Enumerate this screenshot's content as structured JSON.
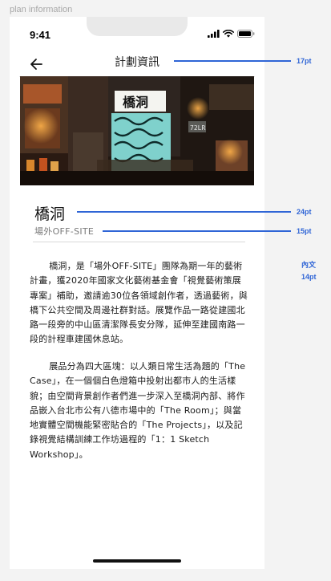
{
  "canvas_label": "plan information",
  "status_bar": {
    "time": "9:41"
  },
  "header": {
    "title": "計劃資訊"
  },
  "hero": {
    "sign_text": "橋洞",
    "plate_text": "72LR"
  },
  "content": {
    "title": "橋洞",
    "subtitle": "場外OFF-SITE",
    "paragraphs": [
      "橋洞，是「場外OFF-SITE」團隊為期一年的藝術計畫，獲2020年國家文化藝術基金會「視覺藝術策展專案」補助，邀請逾30位各領域創作者，透過藝術，與橋下公共空間及周邊社群對話。展覽作品一路從建國北路一段旁的中山區清潔隊長安分隊，延伸至建國南路一段的計程車建國休息站。",
      "展品分為四大區塊：以人類日常生活為題的「The Case」，在一個個白色燈箱中投射出都市人的生活樣貌；由空間背景創作者們進一步深入至橋洞內部、將作品嵌入台北市公有八德市場中的「The Room」；與當地實體空間機能緊密貼合的「The Projects」，以及記錄視覺結構訓練工作坊過程的「1：1 Sketch Workshop」。"
    ]
  },
  "annotations": {
    "header_size": "17pt",
    "title_size": "24pt",
    "subtitle_size": "15pt",
    "body_label": "內文",
    "body_size": "14pt"
  },
  "colors": {
    "annotation": "#2f65d6",
    "background": "#f3f3f3",
    "screen": "#ffffff"
  },
  "icons": [
    "back-arrow-icon",
    "signal-icon",
    "wifi-icon",
    "battery-icon"
  ]
}
